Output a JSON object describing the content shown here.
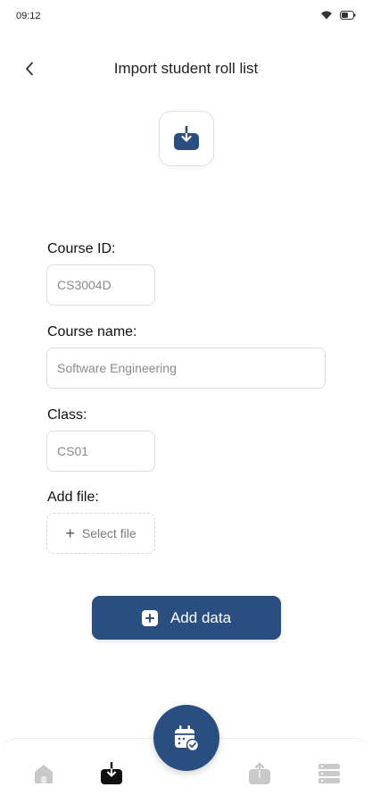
{
  "status_bar": {
    "time": "09:12",
    "icons": [
      "wifi-icon",
      "battery-icon"
    ]
  },
  "header": {
    "title": "Import student roll list",
    "back_icon": "chevron-left-icon"
  },
  "hero": {
    "icon": "download-tray-icon"
  },
  "form": {
    "course_id": {
      "label": "Course ID:",
      "value": "CS3004D"
    },
    "course_name": {
      "label": "Course name:",
      "value": "Software Engineering"
    },
    "class": {
      "label": "Class:",
      "value": "CS01"
    },
    "file": {
      "label": "Add file:",
      "select_label": "Select file"
    }
  },
  "actions": {
    "add_data_label": "Add data"
  },
  "bottom_nav": {
    "items": [
      "home-icon",
      "download-icon",
      "upload-icon",
      "server-icon"
    ],
    "active": "download-icon",
    "fab_icon": "calendar-check-icon"
  },
  "colors": {
    "primary": "#2b4e80",
    "inactive_icon": "#c9c9c9",
    "active_icon": "#111111"
  }
}
